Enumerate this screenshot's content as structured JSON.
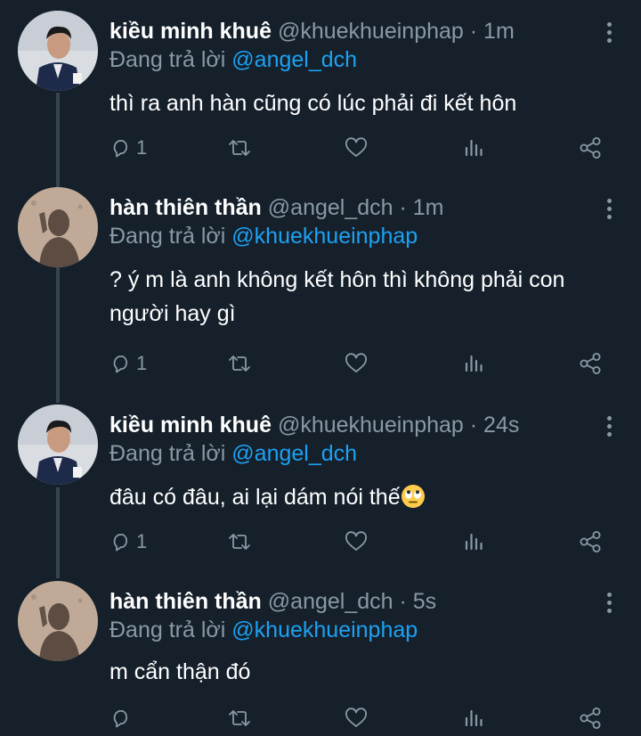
{
  "tweets": [
    {
      "name": "kiều minh khuê",
      "handle": "@khuekhueinphap",
      "separator": "·",
      "time": "1m",
      "reply_prefix": "Đang trả lời",
      "reply_to": "@angel_dch",
      "text": "thì ra anh hàn cũng có lúc phải đi kết hôn",
      "reply_count": "1",
      "avatar_icon": "portrait-man-suit"
    },
    {
      "name": "hàn thiên thần",
      "handle": "@angel_dch",
      "separator": "·",
      "time": "1m",
      "reply_prefix": "Đang trả lời",
      "reply_to": "@khuekhueinphap",
      "text": "? ý m là anh không kết hôn thì không phải con người hay gì",
      "reply_count": "1",
      "avatar_icon": "shadow-silhouette"
    },
    {
      "name": "kiều minh khuê",
      "handle": "@khuekhueinphap",
      "separator": "·",
      "time": "24s",
      "reply_prefix": "Đang trả lời",
      "reply_to": "@angel_dch",
      "text": "đâu có đâu, ai lại dám nói thế",
      "text_emoji": "eye-roll-emoji",
      "reply_count": "1",
      "avatar_icon": "portrait-man-suit"
    },
    {
      "name": "hàn thiên thần",
      "handle": "@angel_dch",
      "separator": "·",
      "time": "5s",
      "reply_prefix": "Đang trả lời",
      "reply_to": "@khuekhueinphap",
      "text": "m cẩn thận đó",
      "reply_count": "",
      "avatar_icon": "shadow-silhouette"
    }
  ],
  "colors": {
    "background": "#15202b",
    "secondary_text": "#8899a6",
    "mention": "#1da1f2",
    "thread_line": "#38444d"
  },
  "action_icons": [
    "reply-icon",
    "retweet-icon",
    "like-icon",
    "analytics-icon",
    "share-icon"
  ]
}
